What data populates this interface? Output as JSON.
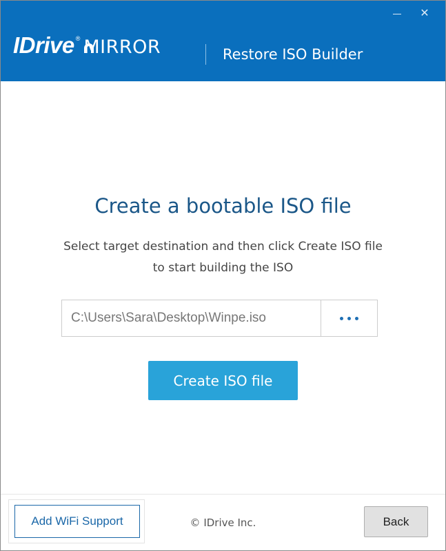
{
  "header": {
    "logo_brand": "IDrive",
    "logo_product": "MIRROR",
    "logo_registered": "®",
    "title": "Restore ISO Builder",
    "minimize_glyph": "—",
    "close_glyph": "✕",
    "background_color": "#0a6fbd"
  },
  "main": {
    "title": "Create a bootable ISO file",
    "subtitle_line1": "Select target destination and then click Create ISO file",
    "subtitle_line2": "to start building the ISO",
    "path_value": "C:\\Users\\Sara\\Desktop\\Winpe.iso",
    "browse_icon": "ellipsis-icon",
    "create_button_label": "Create ISO file",
    "create_button_color": "#29a3d9"
  },
  "footer": {
    "wifi_button_label": "Add WiFi Support",
    "copyright": "© IDrive Inc.",
    "back_button_label": "Back"
  }
}
